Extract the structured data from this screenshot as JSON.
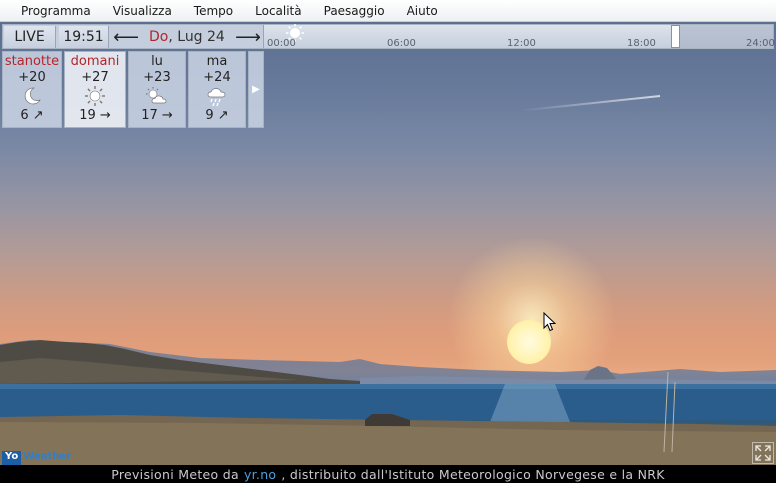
{
  "menu": [
    "Programma",
    "Visualizza",
    "Tempo",
    "Località",
    "Paesaggio",
    "Aiuto"
  ],
  "toolbar": {
    "live": "LIVE",
    "time": "19:51",
    "prev_icon": "arrow-left-icon",
    "day": "Do",
    "date_rest": ", Lug 24",
    "next_icon": "arrow-right-icon",
    "ticks": [
      "00:00",
      "06:00",
      "12:00",
      "18:00",
      "24:00"
    ]
  },
  "forecast": [
    {
      "day": "stanotte",
      "temp": "+20",
      "icon": "moon-icon",
      "wind": "6 ↗",
      "highlight": true
    },
    {
      "day": "domani",
      "temp": "+27",
      "icon": "sun-icon",
      "wind": "19 →",
      "highlight": true
    },
    {
      "day": "lu",
      "temp": "+23",
      "icon": "sun-cloud-icon",
      "wind": "17 →",
      "highlight": false
    },
    {
      "day": "ma",
      "temp": "+24",
      "icon": "rain-icon",
      "wind": "9 ↗",
      "highlight": false
    }
  ],
  "logo": {
    "yo": "Yo",
    "rest": "Weather"
  },
  "footer": {
    "pre": "Previsioni Meteo da",
    "link": "yr.no",
    "post": ", distribuito dall'Istituto Meteorologico Norvegese e la NRK"
  },
  "colors": {
    "accent_red": "#b3262a",
    "link_blue": "#4a9fe0"
  }
}
